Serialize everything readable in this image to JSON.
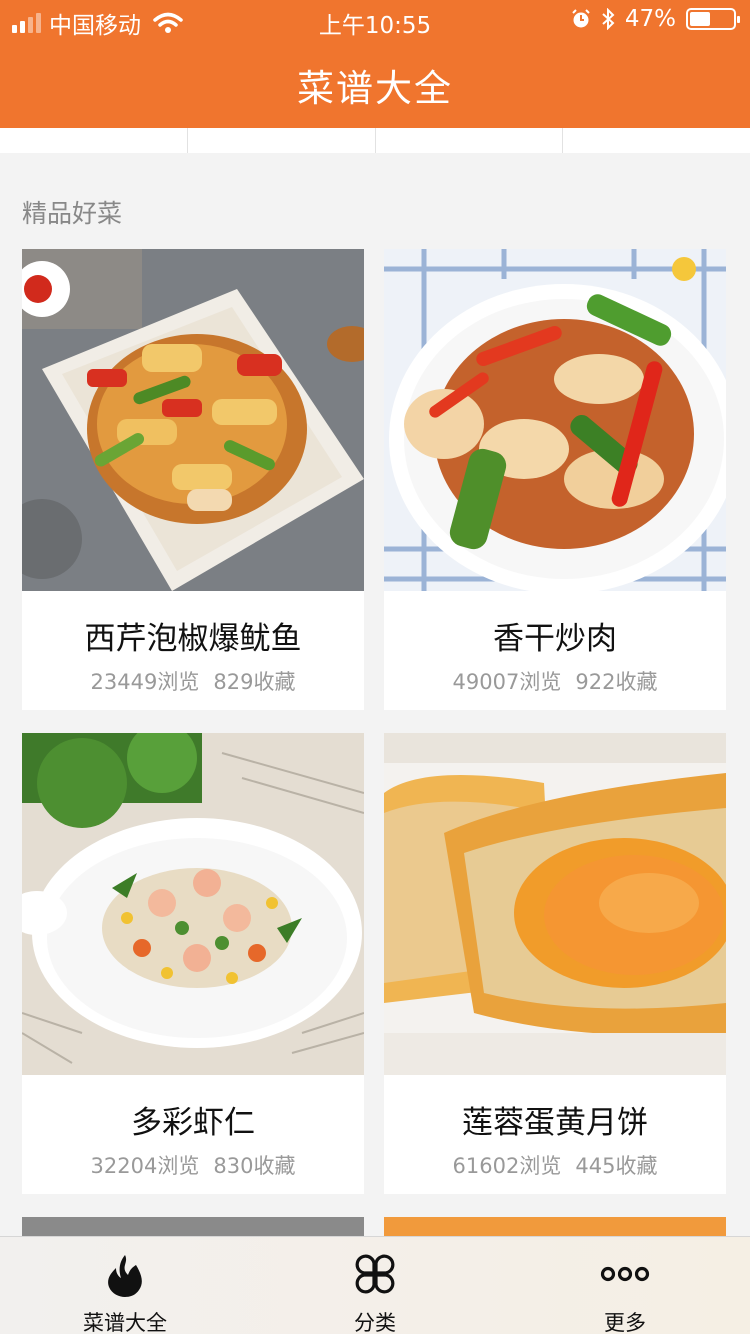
{
  "status_bar": {
    "carrier": "中国移动",
    "time": "上午10:55",
    "battery": "47%",
    "battery_level": 0.47
  },
  "header": {
    "title": "菜谱大全"
  },
  "section": {
    "title": "精品好菜"
  },
  "recipes": [
    {
      "name": "西芹泡椒爆鱿鱼",
      "views": "23449浏览",
      "favorites": "829收藏"
    },
    {
      "name": "香干炒肉",
      "views": "49007浏览",
      "favorites": "922收藏"
    },
    {
      "name": "多彩虾仁",
      "views": "32204浏览",
      "favorites": "830收藏"
    },
    {
      "name": "莲蓉蛋黄月饼",
      "views": "61602浏览",
      "favorites": "445收藏"
    }
  ],
  "tabbar": {
    "items": [
      {
        "label": "菜谱大全",
        "icon": "flame-icon"
      },
      {
        "label": "分类",
        "icon": "category-icon"
      },
      {
        "label": "更多",
        "icon": "more-icon"
      }
    ]
  }
}
